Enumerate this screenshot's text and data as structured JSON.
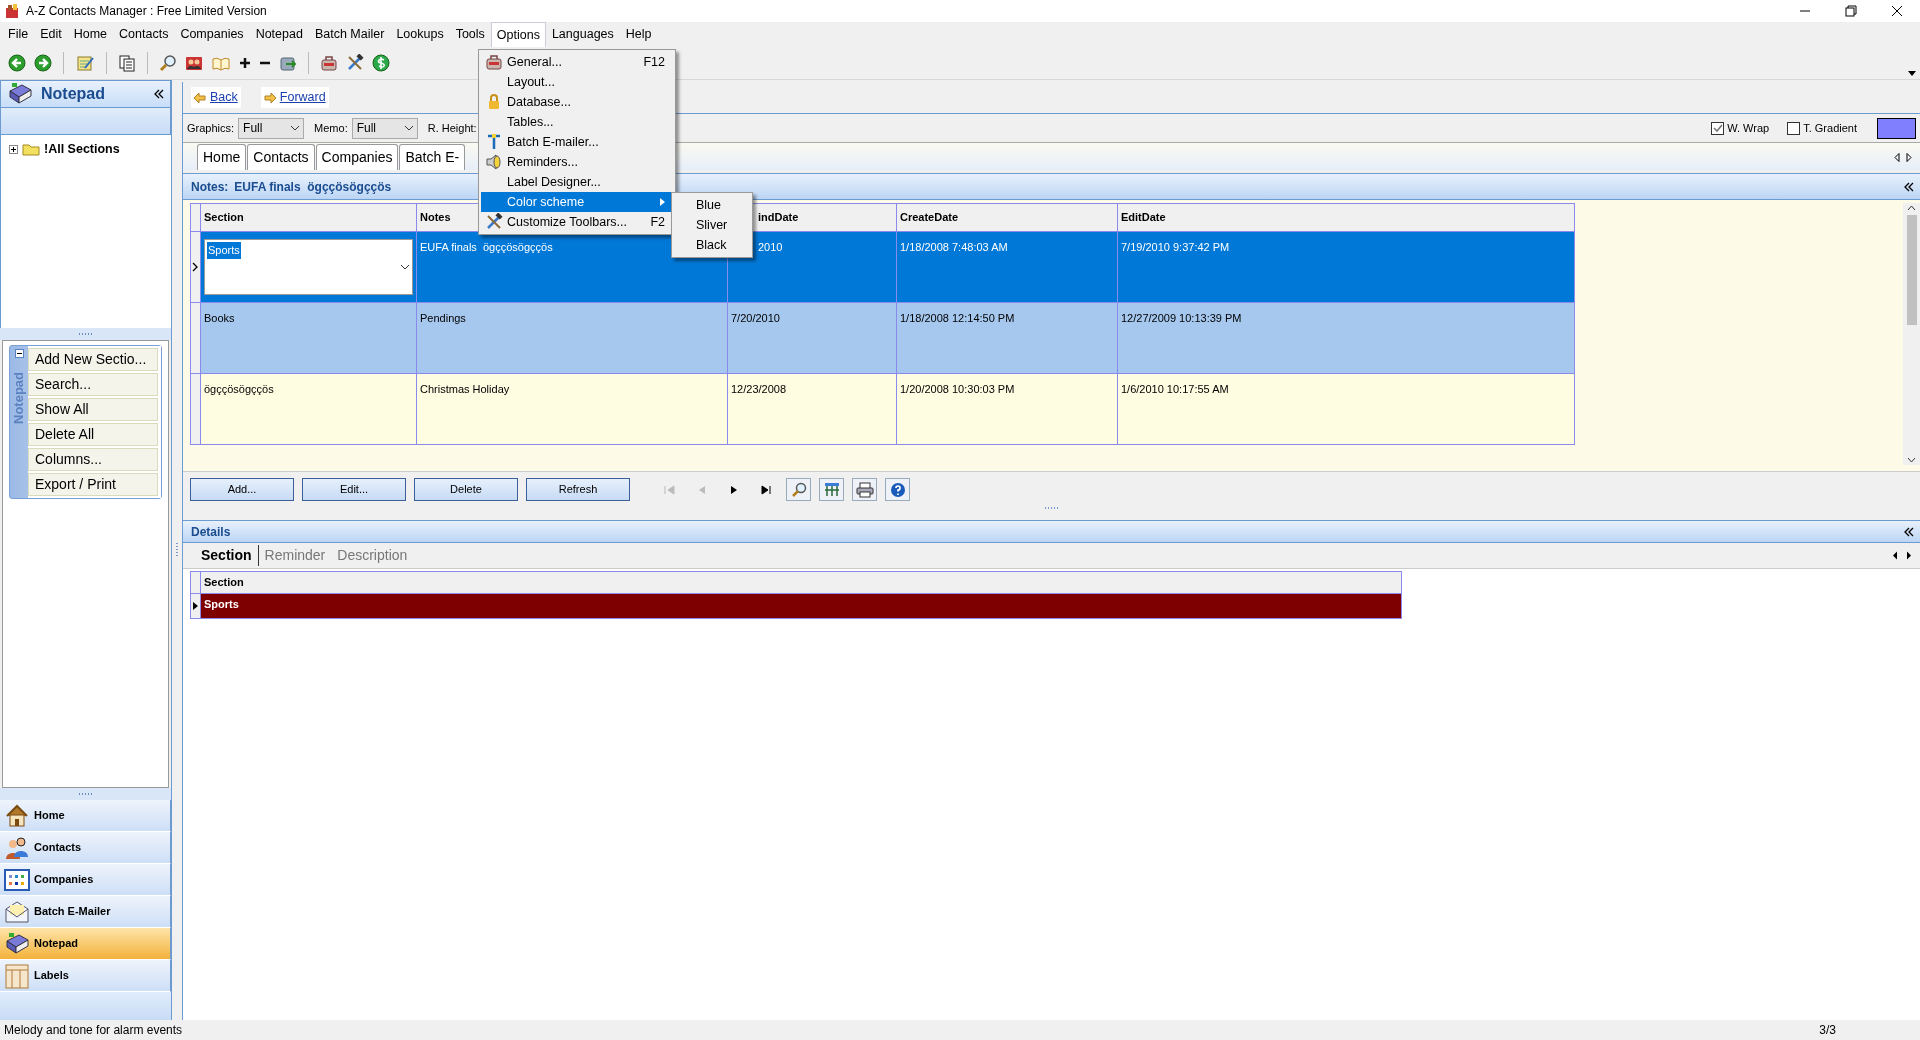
{
  "window": {
    "title": "A-Z Contacts Manager : Free Limited Version"
  },
  "menu_bar": [
    {
      "label": "File",
      "open": false
    },
    {
      "label": "Edit",
      "open": false
    },
    {
      "label": "Home",
      "open": false
    },
    {
      "label": "Contacts",
      "open": false
    },
    {
      "label": "Companies",
      "open": false
    },
    {
      "label": "Notepad",
      "open": false
    },
    {
      "label": "Batch Mailer",
      "open": false
    },
    {
      "label": "Lookups",
      "open": false
    },
    {
      "label": "Tools",
      "open": false
    },
    {
      "label": "Options",
      "open": true
    },
    {
      "label": "Languages",
      "open": false
    },
    {
      "label": "Help",
      "open": false
    }
  ],
  "options_menu": [
    {
      "kind": "toolbox",
      "label": "General...",
      "shortcut": "F12",
      "selected": false,
      "submenu": false
    },
    {
      "kind": "none",
      "label": "Layout...",
      "selected": false,
      "submenu": false
    },
    {
      "kind": "lock",
      "label": "Database...",
      "selected": false,
      "submenu": false
    },
    {
      "kind": "none",
      "label": "Tables...",
      "selected": false,
      "submenu": false
    },
    {
      "kind": "mailer",
      "label": "Batch E-mailer...",
      "selected": false,
      "submenu": false
    },
    {
      "kind": "speaker",
      "label": "Reminders...",
      "selected": false,
      "submenu": false
    },
    {
      "kind": "none",
      "label": "Label Designer...",
      "selected": false,
      "submenu": false
    },
    {
      "kind": "none",
      "label": "Color scheme",
      "selected": true,
      "submenu": true
    },
    {
      "kind": "tools",
      "label": "Customize Toolbars...",
      "shortcut": "F2",
      "selected": false,
      "submenu": false
    }
  ],
  "color_scheme_menu": [
    "Blue",
    "Sliver",
    "Black"
  ],
  "sidebar": {
    "title": "Notepad",
    "tree": [
      {
        "label": "!All Sections",
        "expanded": false
      }
    ],
    "task_group": {
      "title": "Notepad",
      "expanded": true,
      "items": [
        "Add New Sectio...",
        "Search...",
        "Show All",
        "Delete All",
        "Columns...",
        "Export / Print"
      ]
    },
    "nav": [
      {
        "kind": "home",
        "label": "Home",
        "selected": false
      },
      {
        "kind": "contacts",
        "label": "Contacts",
        "selected": false
      },
      {
        "kind": "companies",
        "label": "Companies",
        "selected": false
      },
      {
        "kind": "mailer",
        "label": "Batch E-Mailer",
        "selected": false
      },
      {
        "kind": "notepad",
        "label": "Notepad",
        "selected": true
      },
      {
        "kind": "labels",
        "label": "Labels",
        "selected": false
      }
    ]
  },
  "nav_bar": {
    "back": "Back",
    "forward": "Forward"
  },
  "view_options": {
    "graphics": {
      "label": "Graphics:",
      "value": "Full"
    },
    "memo": {
      "label": "Memo:",
      "value": "Full"
    },
    "row_height": {
      "label": "R. Height:"
    },
    "word_wrap": {
      "label": "W. Wrap",
      "checked": true
    },
    "gradient": {
      "label": "T. Gradient",
      "checked": false
    }
  },
  "tabs": [
    {
      "label": "Home"
    },
    {
      "label": "Contacts"
    },
    {
      "label": "Companies"
    },
    {
      "label": "Batch E-"
    }
  ],
  "notes_header": {
    "label": "Notes:",
    "value": "EUFA finals  ögççösögççös"
  },
  "grid": {
    "columns": [
      "Section",
      "Notes",
      "indDate",
      "CreateDate",
      "EditDate"
    ],
    "rows": [
      {
        "cells": [
          "Sports",
          "EUFA finals  ögççösögççös",
          "2010",
          "1/18/2008 7:48:03 AM",
          "7/19/2010 9:37:42 PM"
        ],
        "selected": true
      },
      {
        "cells": [
          "Books",
          "Pendings",
          "7/20/2010",
          "1/18/2008 12:14:50 PM",
          "12/27/2009 10:13:39 PM"
        ],
        "selected": false
      },
      {
        "cells": [
          "ögççösögççös",
          "Christmas Holiday",
          "12/23/2008",
          "1/20/2008 10:30:03 PM",
          "1/6/2010 10:17:55 AM"
        ],
        "selected": false
      }
    ]
  },
  "grid_buttons": [
    "Add...",
    "Edit...",
    "Delete",
    "Refresh"
  ],
  "record_nav": [
    {
      "kind": "first",
      "disabled": true
    },
    {
      "kind": "prev",
      "disabled": true
    },
    {
      "kind": "next",
      "disabled": false
    },
    {
      "kind": "last",
      "disabled": false
    }
  ],
  "details": {
    "title": "Details",
    "tabs": [
      {
        "label": "Section",
        "selected": true
      },
      {
        "label": "Reminder",
        "selected": false
      },
      {
        "label": "Description",
        "selected": false
      }
    ],
    "grid": {
      "columns": [
        "Section"
      ],
      "rows": [
        {
          "cells": [
            "Sports"
          ],
          "selected": true
        }
      ]
    }
  },
  "status_bar": {
    "message": "Melody and tone for alarm events",
    "record_count": "3/3"
  }
}
